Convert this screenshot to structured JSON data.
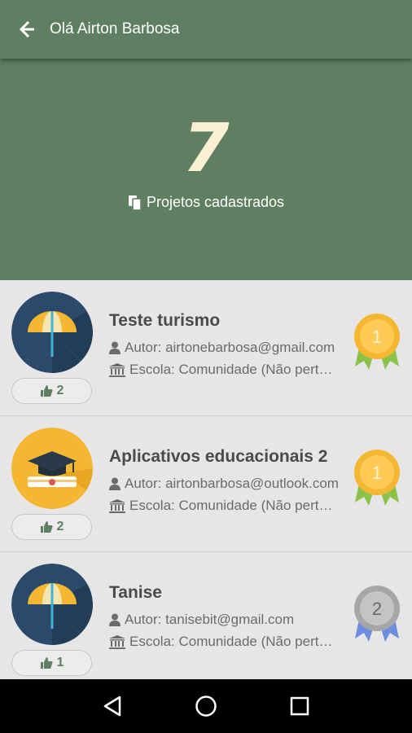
{
  "appbar": {
    "title": "Olá Airton Barbosa",
    "back_icon": "arrow-left-icon"
  },
  "summary": {
    "count": "7",
    "label": "Projetos cadastrados",
    "icon": "copy-icon"
  },
  "colors": {
    "primary": "#5e7f61",
    "count": "#fbf1d2",
    "gold": "#f5b731",
    "silver": "#a6a6a6",
    "ribbon_green": "#8bc34a",
    "ribbon_blue": "#6d8de0"
  },
  "projects": [
    {
      "title": "Teste turismo",
      "author": "Autor: airtonebarbosa@gmail.com",
      "school": "Escola: Comunidade (Não pertence a uma escola)",
      "likes": "2",
      "rank": "1",
      "avatar": "umbrella-icon",
      "medal": "gold"
    },
    {
      "title": "Aplicativos educacionais 2",
      "author": "Autor: airtonbarbosa@outlook.com",
      "school": "Escola: Comunidade (Não pertence a uma escola)",
      "likes": "2",
      "rank": "1",
      "avatar": "graduation-cap-icon",
      "medal": "gold"
    },
    {
      "title": "Tanise",
      "author": "Autor: tanisebit@gmail.com",
      "school": "Escola: Comunidade (Não pertence a uma escola)",
      "likes": "1",
      "rank": "2",
      "avatar": "umbrella-icon",
      "medal": "silver"
    }
  ],
  "navbar": {
    "back": "triangle-back-icon",
    "home": "circle-home-icon",
    "recents": "square-recents-icon"
  }
}
